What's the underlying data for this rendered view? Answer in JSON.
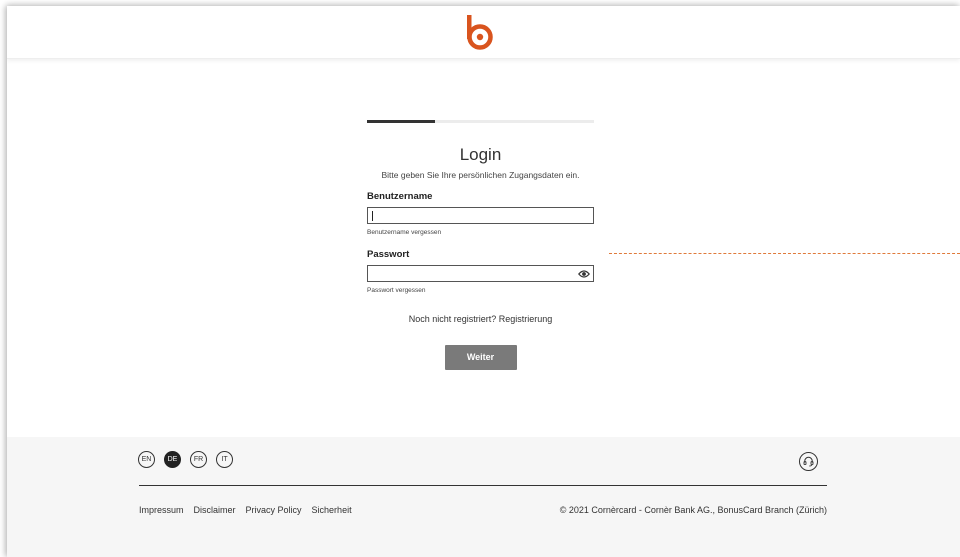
{
  "brand": {
    "logo_icon": "bonuscard-b-logo",
    "accent_color": "#d9541e"
  },
  "login": {
    "progress_fraction": 0.3,
    "title": "Login",
    "subtitle": "Bitte geben Sie Ihre persönlichen Zugangsdaten ein.",
    "username": {
      "label": "Benutzername",
      "value": "",
      "forgot_link": "Benutzername vergessen"
    },
    "password": {
      "label": "Passwort",
      "value": "",
      "forgot_link": "Passwort vergessen",
      "toggle_icon": "eye-icon"
    },
    "register_text": "Noch nicht registriert? Registrierung",
    "submit_label": "Weiter"
  },
  "footer": {
    "languages": [
      {
        "code": "EN",
        "active": false
      },
      {
        "code": "DE",
        "active": true
      },
      {
        "code": "FR",
        "active": false
      },
      {
        "code": "IT",
        "active": false
      }
    ],
    "support_icon": "headset-icon",
    "links": [
      "Impressum",
      "Disclaimer",
      "Privacy Policy",
      "Sicherheit"
    ],
    "copyright": "© 2021 Cornèrcard - Cornèr Bank AG., BonusCard Branch (Zürich)"
  }
}
